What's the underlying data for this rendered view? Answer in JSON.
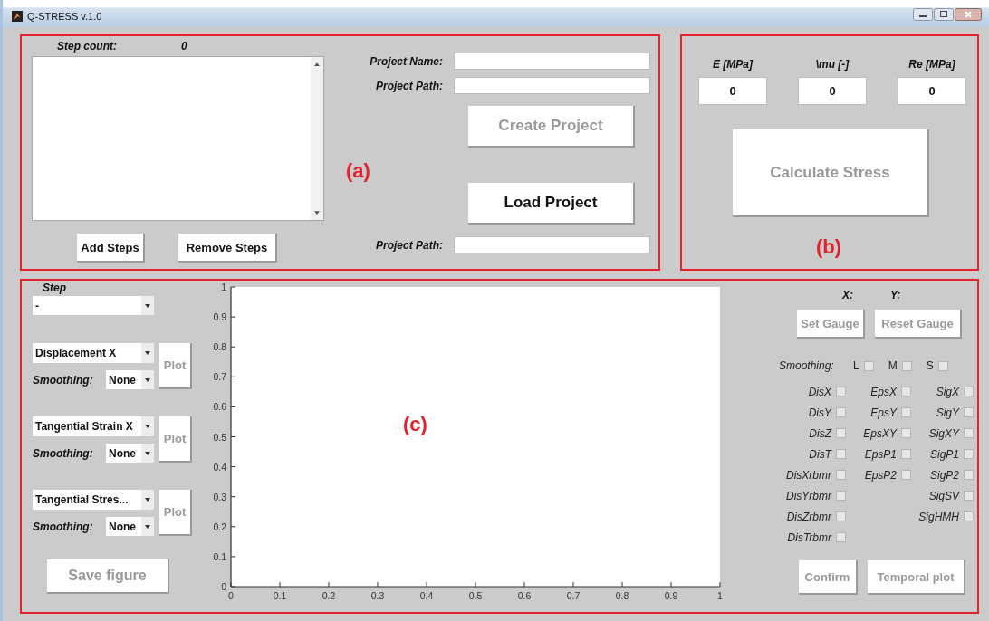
{
  "window": {
    "title": "Q-STRESS v.1.0"
  },
  "panel_a": {
    "label": "(a)",
    "step_count_label": "Step count:",
    "step_count": "0",
    "step_buttons": [
      {
        "label": "Add Steps",
        "disabled": false
      },
      {
        "label": "Remove Steps",
        "disabled": false
      }
    ],
    "project_name": {
      "label": "Project Name:"
    },
    "project_path": {
      "label": "Project Path:"
    },
    "create_button": {
      "label": "Create Project",
      "disabled": true
    },
    "load_button": {
      "label": "Load Project",
      "disabled": false
    },
    "load_path": {
      "label": "Project Path:"
    }
  },
  "panel_b": {
    "label": "(b)",
    "parameters": [
      {
        "label": "E [MPa]",
        "value": "0"
      },
      {
        "label": "\\mu [-]",
        "value": "0"
      },
      {
        "label": "Re [MPa]",
        "value": "0"
      }
    ],
    "calculate_button": {
      "label": "Calculate Stress",
      "disabled": true
    }
  },
  "panel_c": {
    "label": "(c)",
    "step": {
      "label": "Step",
      "value": "-"
    },
    "plot_groups": [
      {
        "quantity": "Displacement X",
        "smoothing_label": "Smoothing:",
        "smoothing": "None",
        "plot_button": {
          "label": "Plot",
          "disabled": true
        }
      },
      {
        "quantity": "Tangential Strain X",
        "smoothing_label": "Smoothing:",
        "smoothing": "None",
        "plot_button": {
          "label": "Plot",
          "disabled": true
        }
      },
      {
        "quantity": "Tangential Stres...",
        "smoothing_label": "Smoothing:",
        "smoothing": "None",
        "plot_button": {
          "label": "Plot",
          "disabled": true
        }
      }
    ],
    "save_button": {
      "label": "Save figure",
      "disabled": true
    },
    "chart_data": {
      "type": "line",
      "xlim": [
        0,
        1
      ],
      "ylim": [
        0,
        1
      ],
      "xticks": [
        0,
        0.1,
        0.2,
        0.3,
        0.4,
        0.5,
        0.6,
        0.7,
        0.8,
        0.9,
        1
      ],
      "yticks": [
        0,
        0.1,
        0.2,
        0.3,
        0.4,
        0.5,
        0.6,
        0.7,
        0.8,
        0.9,
        1
      ]
    },
    "gauge": {
      "x_label": "X:",
      "y_label": "Y:",
      "buttons": [
        {
          "label": "Set Gauge",
          "disabled": true
        },
        {
          "label": "Reset Gauge",
          "disabled": true
        }
      ]
    },
    "smoothing": {
      "label": "Smoothing:",
      "options": [
        {
          "label": "L",
          "checked": false
        },
        {
          "label": "M",
          "checked": false
        },
        {
          "label": "S",
          "checked": false
        }
      ]
    },
    "checkbox_columns": [
      {
        "items": [
          {
            "label": "DisX",
            "checked": false
          },
          {
            "label": "DisY",
            "checked": false
          },
          {
            "label": "DisZ",
            "checked": false
          },
          {
            "label": "DisT",
            "checked": false
          },
          {
            "label": "DisXrbmr",
            "checked": false
          },
          {
            "label": "DisYrbmr",
            "checked": false
          },
          {
            "label": "DisZrbmr",
            "checked": false
          },
          {
            "label": "DisTrbmr",
            "checked": false
          }
        ]
      },
      {
        "items": [
          {
            "label": "EpsX",
            "checked": false
          },
          {
            "label": "EpsY",
            "checked": false
          },
          {
            "label": "EpsXY",
            "checked": false
          },
          {
            "label": "EpsP1",
            "checked": false
          },
          {
            "label": "EpsP2",
            "checked": false
          }
        ]
      },
      {
        "items": [
          {
            "label": "SigX",
            "checked": false
          },
          {
            "label": "SigY",
            "checked": false
          },
          {
            "label": "SigXY",
            "checked": false
          },
          {
            "label": "SigP1",
            "checked": false
          },
          {
            "label": "SigP2",
            "checked": false
          },
          {
            "label": "SigSV",
            "checked": false
          },
          {
            "label": "SigHMH",
            "checked": false
          }
        ]
      }
    ],
    "bottom_buttons": [
      {
        "label": "Confirm",
        "disabled": true
      },
      {
        "label": "Temporal plot",
        "disabled": true
      }
    ]
  }
}
